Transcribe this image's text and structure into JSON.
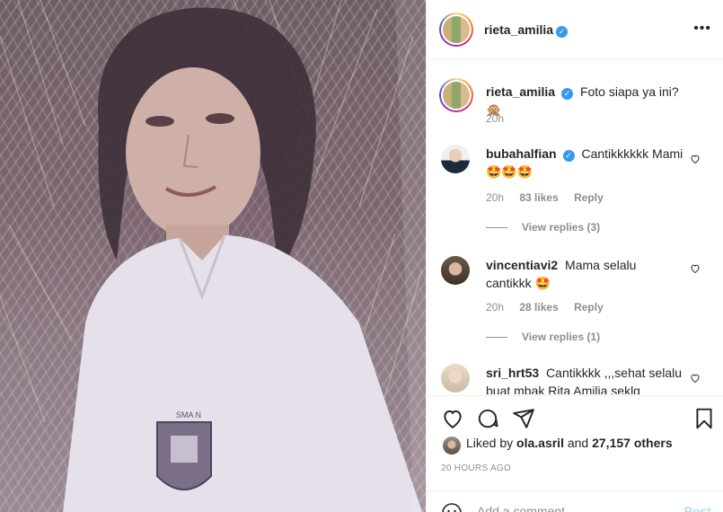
{
  "post": {
    "author": "rieta_amilia",
    "more_label": "•••"
  },
  "caption": {
    "username": "rieta_amilia",
    "text": "Foto siapa ya ini?",
    "emoji": "🙊",
    "time": "20h"
  },
  "comments": [
    {
      "username": "bubahalfian",
      "text": "Cantikkkkkk Mami",
      "emoji_line": "🤩🤩🤩",
      "time": "20h",
      "likes": "83 likes",
      "reply": "Reply",
      "view_replies": "View replies (3)"
    },
    {
      "username": "vincentiavi2",
      "text": "Mama selalu cantikkk",
      "emoji": "🤩",
      "time": "20h",
      "likes": "28 likes",
      "reply": "Reply",
      "view_replies": "View replies (1)"
    },
    {
      "username": "sri_hrt53",
      "text": "Cantikkkk ,,,sehat selalu buat mbak Rita Amilia seklg"
    }
  ],
  "likes": {
    "prefix": "Liked by",
    "user": "ola.asril",
    "joiner": "and",
    "others": "27,157 others"
  },
  "timestamp": "20 HOURS AGO",
  "comment_box": {
    "placeholder": "Add a comment...",
    "post_label": "Post"
  },
  "photo": {
    "badge_text": "SMA N"
  }
}
